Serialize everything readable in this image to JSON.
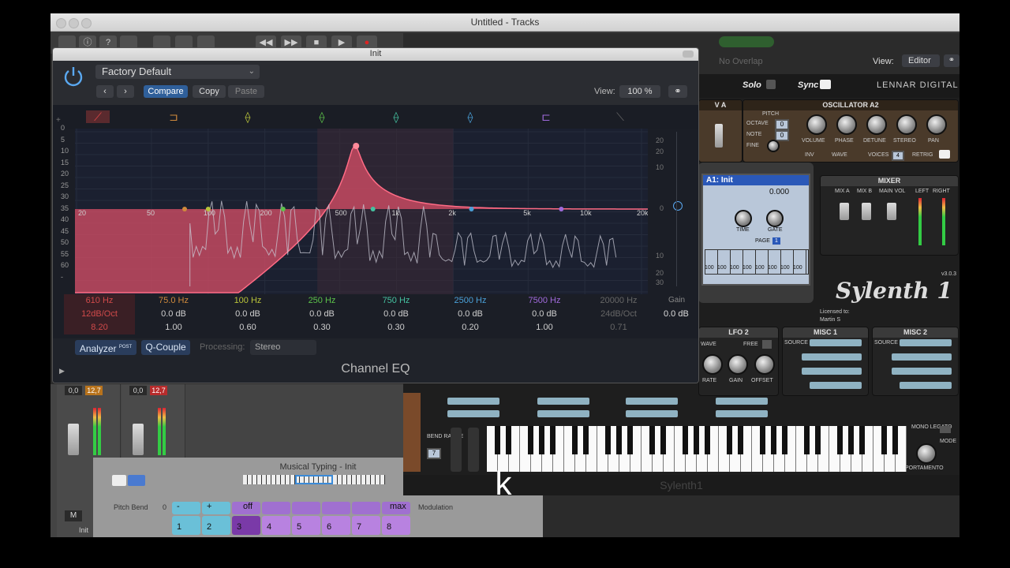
{
  "window": {
    "title": "Untitled - Tracks"
  },
  "mixer": {
    "strip1": {
      "vol": "0,0",
      "peak": "12,7"
    },
    "strip2": {
      "vol": "0,0",
      "peak": "12,7"
    },
    "m_label": "M",
    "bottom_label": "Init"
  },
  "musical_typing": {
    "title": "Musical Typing - Init",
    "pitch_bend_label": "Pitch Bend",
    "pitch_bend_value": "0",
    "modulation_label": "Modulation",
    "off_label": "off",
    "max_label": "max",
    "keys": [
      "1",
      "2",
      "3",
      "4",
      "5",
      "6",
      "7",
      "8"
    ],
    "small_keys": [
      "-",
      "+"
    ]
  },
  "eq": {
    "window_title": "Init",
    "preset": "Factory Default",
    "compare": "Compare",
    "copy": "Copy",
    "paste": "Paste",
    "view_label": "View:",
    "view_value": "100 %",
    "plugin_name": "Channel EQ",
    "analyzer": "Analyzer",
    "analyzer_post": "POST",
    "qcouple": "Q-Couple",
    "processing_label": "Processing:",
    "processing_value": "Stereo",
    "gain_label": "Gain",
    "gain_value": "0.0 dB",
    "left_scale": [
      "+",
      "0",
      "5",
      "10",
      "15",
      "20",
      "25",
      "30",
      "35",
      "40",
      "45",
      "50",
      "55",
      "60",
      "-"
    ],
    "right_scale": [
      "20",
      "20",
      "10",
      "0",
      "10",
      "20",
      "30"
    ],
    "freq_labels": [
      "20",
      "50",
      "100",
      "200",
      "500",
      "1k",
      "2k",
      "5k",
      "10k",
      "20k"
    ],
    "bands": [
      {
        "freq": "610 Hz",
        "gain": "12dB/Oct",
        "q": "8.20",
        "color": "#d23b3b"
      },
      {
        "freq": "75.0 Hz",
        "gain": "0.0 dB",
        "q": "1.00",
        "color": "#d08a3c"
      },
      {
        "freq": "100 Hz",
        "gain": "0.0 dB",
        "q": "0.60",
        "color": "#b8c23a"
      },
      {
        "freq": "250 Hz",
        "gain": "0.0 dB",
        "q": "0.30",
        "color": "#5cc24a"
      },
      {
        "freq": "750 Hz",
        "gain": "0.0 dB",
        "q": "0.30",
        "color": "#45c2a0"
      },
      {
        "freq": "2500 Hz",
        "gain": "0.0 dB",
        "q": "0.20",
        "color": "#4aa0d8"
      },
      {
        "freq": "7500 Hz",
        "gain": "0.0 dB",
        "q": "1.00",
        "color": "#a06adc"
      },
      {
        "freq": "20000 Hz",
        "gain": "24dB/Oct",
        "q": "0.71",
        "color": "#777777"
      }
    ]
  },
  "sylenth": {
    "footer_title": "Sylenth1",
    "solo": "Solo",
    "sync": "Sync",
    "brand": "LENNAR DIGITAL",
    "view_label": "View:",
    "view_value": "Editor",
    "no_overlap": "No Overlap",
    "osc_title": "OSCILLATOR A2",
    "osc_short": "V A",
    "pitch": "PITCH",
    "octave": "OCTAVE",
    "note": "NOTE",
    "fine": "FINE",
    "inv": "INV",
    "wave": "WAVE",
    "voices": "VOICES",
    "retrig": "RETRIG",
    "knob_labels": [
      "VOLUME",
      "PHASE",
      "DETUNE",
      "STEREO",
      "PAN"
    ],
    "octave_value": "0",
    "note_value": "0",
    "voices_value": "4",
    "mixer_title": "MIXER",
    "mixer_labels": [
      "MIX A",
      "MIX B",
      "MAIN VOL",
      "LEFT",
      "RIGHT"
    ],
    "lcd_title": "A1: Init",
    "lcd_value": "0.000",
    "lcd_knobs": [
      "TIME",
      "GATE"
    ],
    "lcd_page": "PAGE",
    "lcd_page_num": "1",
    "lcd_grid": [
      "100",
      "100",
      "100",
      "100",
      "100",
      "100",
      "100",
      "100"
    ],
    "logo": "Sylenth 1",
    "version": "v3.0.3",
    "licensed": "Licensed to:",
    "licensee": "Martin S",
    "lfo_title": "LFO 2",
    "lfo_wave": "WAVE",
    "lfo_free": "FREE",
    "lfo_knobs": [
      "RATE",
      "GAIN",
      "OFFSET"
    ],
    "misc1": "MISC 1",
    "misc2": "MISC 2",
    "source": "SOURCE",
    "bend_range": "BEND RANGE",
    "bend_value": "7",
    "mono_legato": "MONO LEGATO",
    "mode": "MODE",
    "portamento": "PORTAMENTO"
  },
  "overlay": {
    "letter": "k"
  }
}
